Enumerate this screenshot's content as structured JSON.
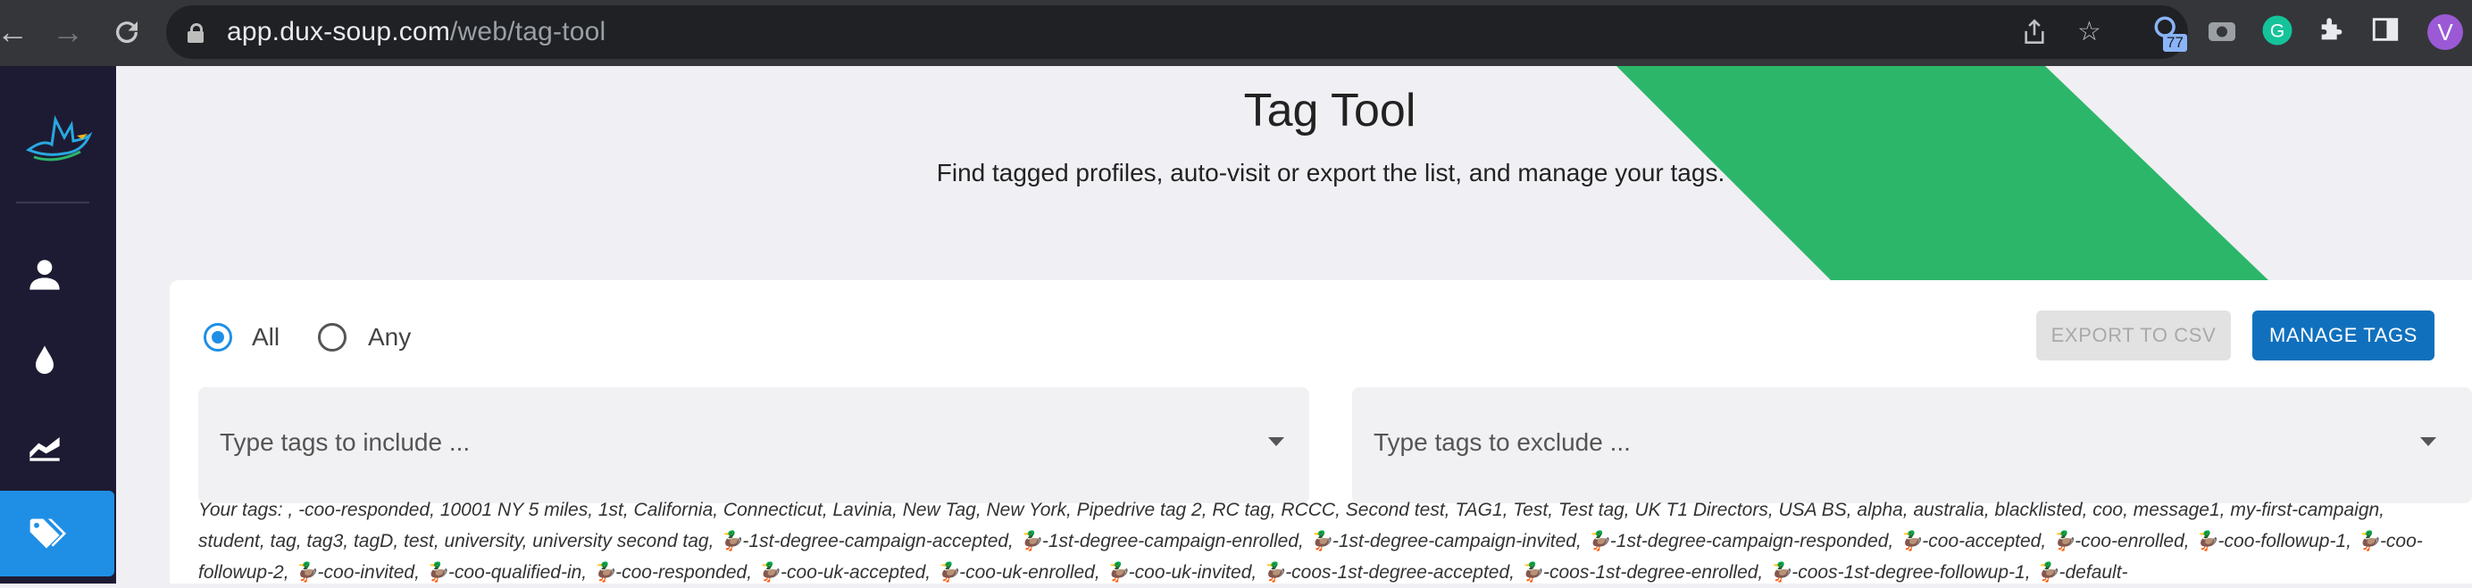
{
  "browser": {
    "url_host": "app.dux-soup.com",
    "url_path": "/web/tag-tool",
    "ext_badge": "77",
    "profile_initial": "V"
  },
  "sidebar": {
    "items": [
      {
        "icon": "person-icon"
      },
      {
        "icon": "drop-icon"
      },
      {
        "icon": "chart-area-icon"
      },
      {
        "icon": "tags-icon",
        "active": true
      }
    ]
  },
  "header": {
    "title": "Tag Tool",
    "subtitle": "Find tagged profiles, auto-visit or export the list, and manage your tags."
  },
  "filters": {
    "mode_all": "All",
    "mode_any": "Any",
    "selected": "All",
    "include_placeholder": "Type tags to include ...",
    "exclude_placeholder": "Type tags to exclude ..."
  },
  "actions": {
    "export_label": "EXPORT TO CSV",
    "manage_label": "MANAGE TAGS"
  },
  "tags_text": "Your tags: , -coo-responded, 10001 NY 5 miles, 1st, California, Connecticut, Lavinia, New Tag, New York, Pipedrive tag 2, RC tag, RCCC, Second test, TAG1, Test, Test tag, UK T1 Directors, USA BS, alpha, australia, blacklisted, coo, message1, my-first-campaign, student, tag, tag3, tagD, test, university, university second tag, 🦆-1st-degree-campaign-accepted, 🦆-1st-degree-campaign-enrolled, 🦆-1st-degree-campaign-invited, 🦆-1st-degree-campaign-responded, 🦆-coo-accepted, 🦆-coo-enrolled, 🦆-coo-followup-1, 🦆-coo-followup-2, 🦆-coo-invited, 🦆-coo-qualified-in, 🦆-coo-responded, 🦆-coo-uk-accepted, 🦆-coo-uk-enrolled, 🦆-coo-uk-invited, 🦆-coos-1st-degree-accepted, 🦆-coos-1st-degree-enrolled, 🦆-coos-1st-degree-followup-1, 🦆-default-",
  "colors": {
    "accent": "#1f8fe6",
    "sidebar_bg": "#1d1b33",
    "brand_green": "#2cb66a",
    "manage_button": "#1070bd"
  }
}
